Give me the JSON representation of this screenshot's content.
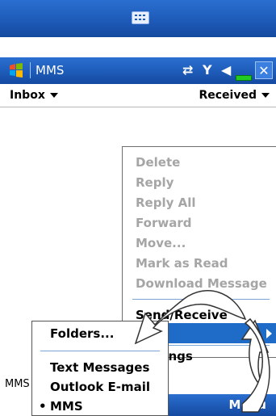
{
  "title_bar": {
    "app_title": "MMS",
    "icons": [
      "connectivity-icon",
      "signal-off-icon",
      "volume-icon",
      "battery-icon"
    ],
    "close_label": "✕"
  },
  "filter_bar": {
    "folder": "Inbox",
    "sort": "Received"
  },
  "menu": {
    "items": [
      {
        "label": "Delete",
        "enabled": false
      },
      {
        "label": "Reply",
        "enabled": false
      },
      {
        "label": "Reply All",
        "enabled": false
      },
      {
        "label": "Forward",
        "enabled": false
      },
      {
        "label": "Move...",
        "enabled": false
      },
      {
        "label": "Mark as Read",
        "enabled": false
      },
      {
        "label": "Download Message",
        "enabled": false
      },
      {
        "label": "Send/Receive",
        "enabled": true
      },
      {
        "label": "Settings",
        "enabled": true
      }
    ]
  },
  "submenu": {
    "items": [
      {
        "label": "Folders...",
        "selected": false
      },
      {
        "label": "Text Messages",
        "selected": false
      },
      {
        "label": "Outlook E-mail",
        "selected": false
      },
      {
        "label": "MMS",
        "selected": true
      }
    ],
    "bullet": "•"
  },
  "status_fragment": "MMS",
  "softkey": {
    "right": "Menu"
  },
  "colors": {
    "accent": "#1e5bb8",
    "highlight": "#1f6cc8",
    "disabled_text": "#a5a5a5"
  }
}
